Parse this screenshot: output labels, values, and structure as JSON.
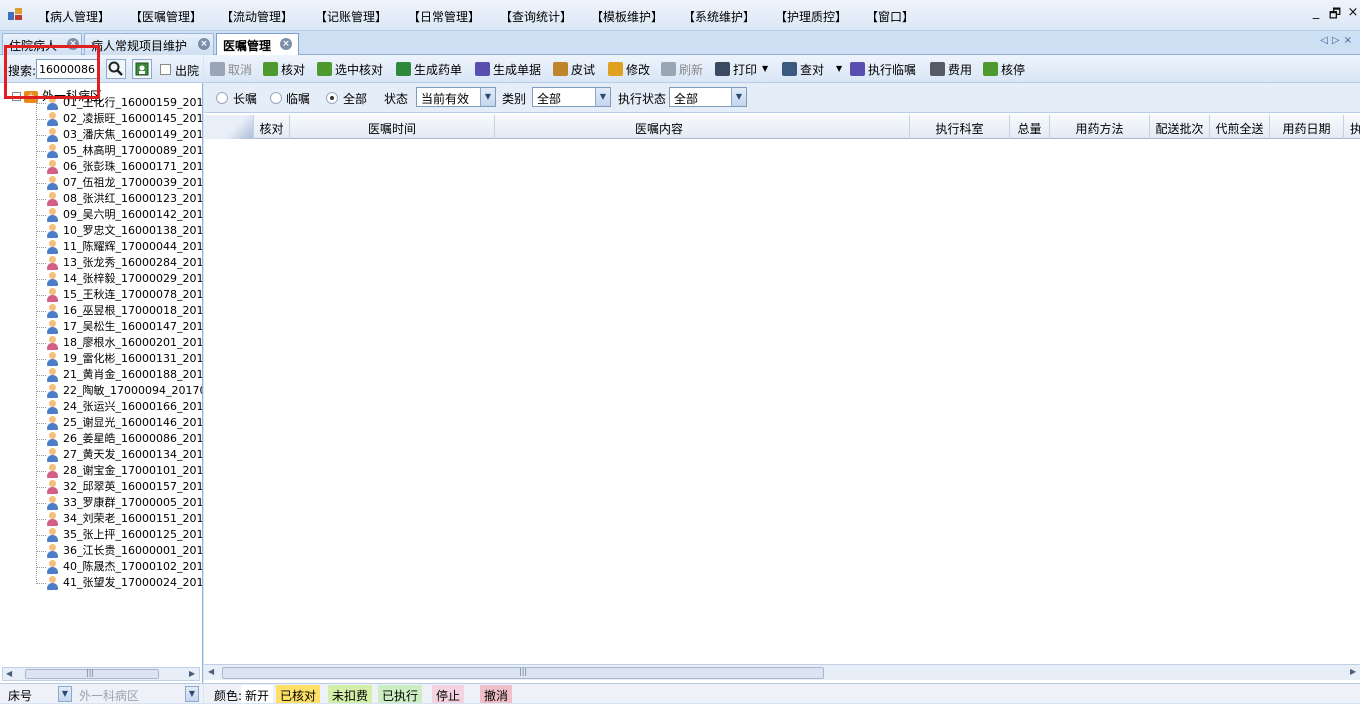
{
  "menu": [
    "【病人管理】",
    "【医嘱管理】",
    "【流动管理】",
    "【记账管理】",
    "【日常管理】",
    "【查询统计】",
    "【模板维护】",
    "【系统维护】",
    "【护理质控】",
    "【窗口】"
  ],
  "window_buttons": {
    "minimize": "_",
    "restore": "🗗",
    "close": "×"
  },
  "tabs": [
    {
      "label": "住院病人",
      "active": false
    },
    {
      "label": "病人常规项目维护",
      "active": false
    },
    {
      "label": "医嘱管理",
      "active": true
    }
  ],
  "left": {
    "search_label": "搜索:",
    "search_value": "16000086",
    "discharge_label": "出院",
    "ward": "外一科病区",
    "patients": [
      {
        "label": "01_王化行_16000159_201",
        "f": false
      },
      {
        "label": "02_凌振旺_16000145_201",
        "f": false
      },
      {
        "label": "03_潘庆焦_16000149_201",
        "f": false
      },
      {
        "label": "05_林高明_17000089_201",
        "f": false
      },
      {
        "label": "06_张彭珠_16000171_201",
        "f": true
      },
      {
        "label": "07_伍祖龙_17000039_201",
        "f": false
      },
      {
        "label": "08_张洪红_16000123_201",
        "f": true
      },
      {
        "label": "09_吴六明_16000142_201",
        "f": false
      },
      {
        "label": "10_罗忠文_16000138_201",
        "f": false
      },
      {
        "label": "11_陈耀辉_17000044_201",
        "f": false
      },
      {
        "label": "13_张龙秀_16000284_201",
        "f": true
      },
      {
        "label": "14_张梓毅_17000029_201",
        "f": false
      },
      {
        "label": "15_王秋连_17000078_201",
        "f": true
      },
      {
        "label": "16_巫昱根_17000018_201",
        "f": false
      },
      {
        "label": "17_吴松生_16000147_201",
        "f": false
      },
      {
        "label": "18_廖根水_16000201_201",
        "f": true
      },
      {
        "label": "19_雷化彬_16000131_201",
        "f": false
      },
      {
        "label": "21_黄肖金_16000188_201",
        "f": false
      },
      {
        "label": "22_陶敏_17000094_20170",
        "f": false
      },
      {
        "label": "24_张运兴_16000166_201",
        "f": false
      },
      {
        "label": "25_谢显光_16000146_201",
        "f": false
      },
      {
        "label": "26_姜星皓_16000086_201",
        "f": false
      },
      {
        "label": "27_黄天发_16000134_201",
        "f": false
      },
      {
        "label": "28_谢宝金_17000101_201",
        "f": true
      },
      {
        "label": "32_邱翠英_16000157_201",
        "f": true
      },
      {
        "label": "33_罗康群_17000005_201",
        "f": false
      },
      {
        "label": "34_刘荣老_16000151_201",
        "f": true
      },
      {
        "label": "35_张上抨_16000125_201",
        "f": false
      },
      {
        "label": "36_江长贵_16000001_201",
        "f": false
      },
      {
        "label": "40_陈晟杰_17000102_201",
        "f": false
      },
      {
        "label": "41_张望发_17000024_201",
        "f": false
      }
    ],
    "footer_bed": "床号",
    "footer_ward": "外一科病区",
    "scroll_grip": "|||"
  },
  "toolbar": [
    {
      "label": "取消",
      "icon": "undo-icon",
      "color": "#9aa5b5",
      "disabled": true
    },
    {
      "label": "核对",
      "icon": "check-icon",
      "color": "#4e9a2e",
      "disabled": false
    },
    {
      "label": "选中核对",
      "icon": "check-icon",
      "color": "#4e9a2e",
      "disabled": false
    },
    {
      "label": "生成药单",
      "icon": "medicine-icon",
      "color": "#2e8a3a",
      "disabled": false
    },
    {
      "label": "生成单据",
      "icon": "gear-icon",
      "color": "#5a4fb0",
      "disabled": false
    },
    {
      "label": "皮试",
      "icon": "syringe-icon",
      "color": "#c0842a",
      "disabled": false
    },
    {
      "label": "修改",
      "icon": "eraser-icon",
      "color": "#e0a020",
      "disabled": false
    },
    {
      "label": "刷新",
      "icon": "refresh-icon",
      "color": "#9aa5b5",
      "disabled": true
    },
    {
      "label": "打印",
      "icon": "printer-icon",
      "color": "#3a4a60",
      "disabled": false
    },
    {
      "label": "查对",
      "icon": "magnifier-icon",
      "color": "#3a5a80",
      "disabled": false
    },
    {
      "label": "执行临嘱",
      "icon": "gear-icon",
      "color": "#5a4fb0",
      "disabled": false
    },
    {
      "label": "费用",
      "icon": "calculator-icon",
      "color": "#555a66",
      "disabled": false
    },
    {
      "label": "核停",
      "icon": "check-icon",
      "color": "#4e9a2e",
      "disabled": false
    }
  ],
  "filter": {
    "radio_long": "长嘱",
    "radio_temp": "临嘱",
    "radio_all": "全部",
    "status_label": "状态",
    "status_value": "当前有效",
    "category_label": "类别",
    "category_value": "全部",
    "exec_label": "执行状态",
    "exec_value": "全部"
  },
  "columns": [
    "核对",
    "医嘱时间",
    "医嘱内容",
    "执行科室",
    "总量",
    "用药方法",
    "配送批次",
    "代煎全送",
    "用药日期",
    "执"
  ],
  "scroll_grip": "|||",
  "legend": {
    "title": "颜色:",
    "items": [
      {
        "label": "新开",
        "color": "#ffffff"
      },
      {
        "label": "已核对",
        "color": "#ffe066"
      },
      {
        "label": "未扣费",
        "color": "#d4f0a8"
      },
      {
        "label": "已执行",
        "color": "#cdeec4"
      },
      {
        "label": "停止",
        "color": "#f4d4e0"
      },
      {
        "label": "撤消",
        "color": "#f0c0c8"
      }
    ]
  }
}
